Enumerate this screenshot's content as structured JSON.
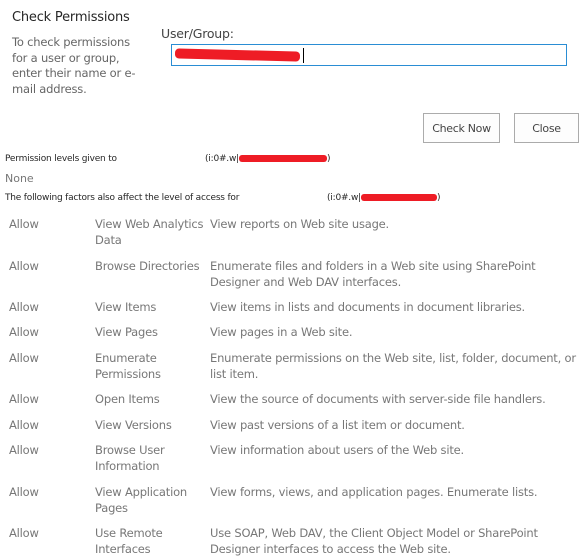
{
  "dialog": {
    "title": "Check Permissions",
    "help_text": "To check permissions for a user or group, enter their name or e-mail address.",
    "user_group_label": "User/Group:",
    "user_group_value": "[redacted]",
    "buttons": {
      "check_now": "Check Now",
      "close": "Close"
    }
  },
  "results": {
    "levels_label": "Permission levels given to",
    "levels_user_prefix": "(i:0#.w|",
    "levels_user_suffix": ")",
    "levels_value": "None",
    "factors_label": "The following factors also affect the level of access for",
    "factors_user_prefix": "(i:0#.w|",
    "factors_user_suffix": ")",
    "redaction_color": "#ee1c25",
    "permissions": [
      {
        "access": "Allow",
        "name": "View Web Analytics Data",
        "description": "View reports on Web site usage."
      },
      {
        "access": "Allow",
        "name": "Browse Directories",
        "description": "Enumerate files and folders in a Web site using SharePoint Designer and Web DAV interfaces."
      },
      {
        "access": "Allow",
        "name": "View Items",
        "description": "View items in lists and documents in document libraries."
      },
      {
        "access": "Allow",
        "name": "View Pages",
        "description": "View pages in a Web site."
      },
      {
        "access": "Allow",
        "name": "Enumerate Permissions",
        "description": "Enumerate permissions on the Web site, list, folder, document, or list item."
      },
      {
        "access": "Allow",
        "name": "Open Items",
        "description": "View the source of documents with server-side file handlers."
      },
      {
        "access": "Allow",
        "name": "View Versions",
        "description": "View past versions of a list item or document."
      },
      {
        "access": "Allow",
        "name": "Browse User Information",
        "description": "View information about users of the Web site."
      },
      {
        "access": "Allow",
        "name": "View Application Pages",
        "description": "View forms, views, and application pages. Enumerate lists."
      },
      {
        "access": "Allow",
        "name": "Use Remote Interfaces",
        "description": "Use SOAP, Web DAV, the Client Object Model or SharePoint Designer interfaces to access the Web site."
      }
    ]
  }
}
